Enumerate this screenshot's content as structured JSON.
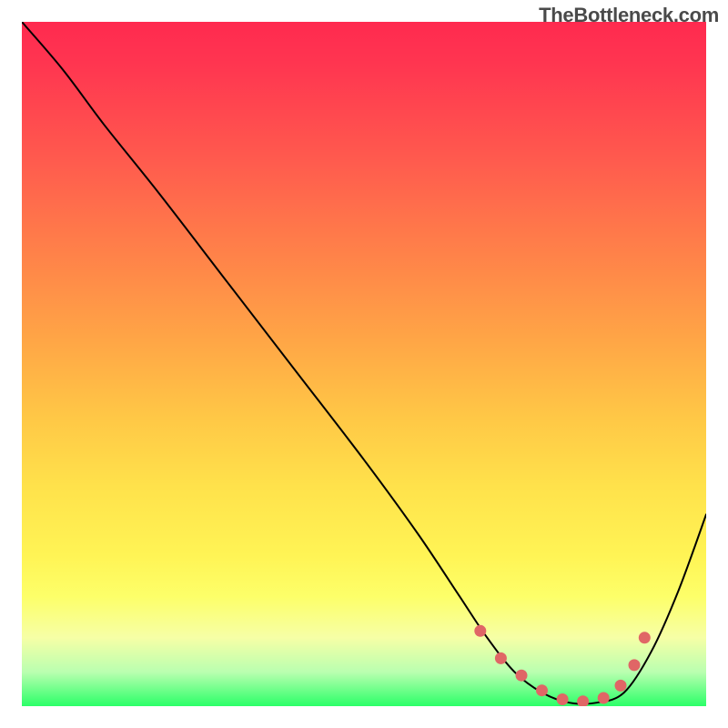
{
  "watermark": "TheBottleneck.com",
  "chart_data": {
    "type": "line",
    "title": "",
    "xlabel": "",
    "ylabel": "",
    "xlim": [
      0,
      100
    ],
    "ylim": [
      0,
      100
    ],
    "series": [
      {
        "name": "bottleneck-curve",
        "x": [
          0,
          6,
          12,
          20,
          30,
          40,
          50,
          58,
          64,
          68,
          72,
          76,
          80,
          84,
          88,
          92,
          96,
          100
        ],
        "values": [
          100,
          93,
          85,
          75,
          62,
          49,
          36,
          25,
          16,
          10,
          5,
          2,
          0.5,
          0.5,
          2,
          8,
          17,
          28
        ]
      }
    ],
    "dots": {
      "name": "optimal-zone",
      "color": "#e06666",
      "x": [
        67,
        70,
        73,
        76,
        79,
        82,
        85,
        87.5,
        89.5,
        91
      ],
      "values": [
        11,
        7,
        4.5,
        2.3,
        1,
        0.7,
        1.2,
        3,
        6,
        10
      ]
    },
    "gradient_stops": [
      {
        "pos": 0,
        "color": "#ff2a4f"
      },
      {
        "pos": 20,
        "color": "#ff5a4e"
      },
      {
        "pos": 47,
        "color": "#ffa746"
      },
      {
        "pos": 68,
        "color": "#ffe24b"
      },
      {
        "pos": 90,
        "color": "#f6ffa6"
      },
      {
        "pos": 100,
        "color": "#2bff68"
      }
    ]
  }
}
